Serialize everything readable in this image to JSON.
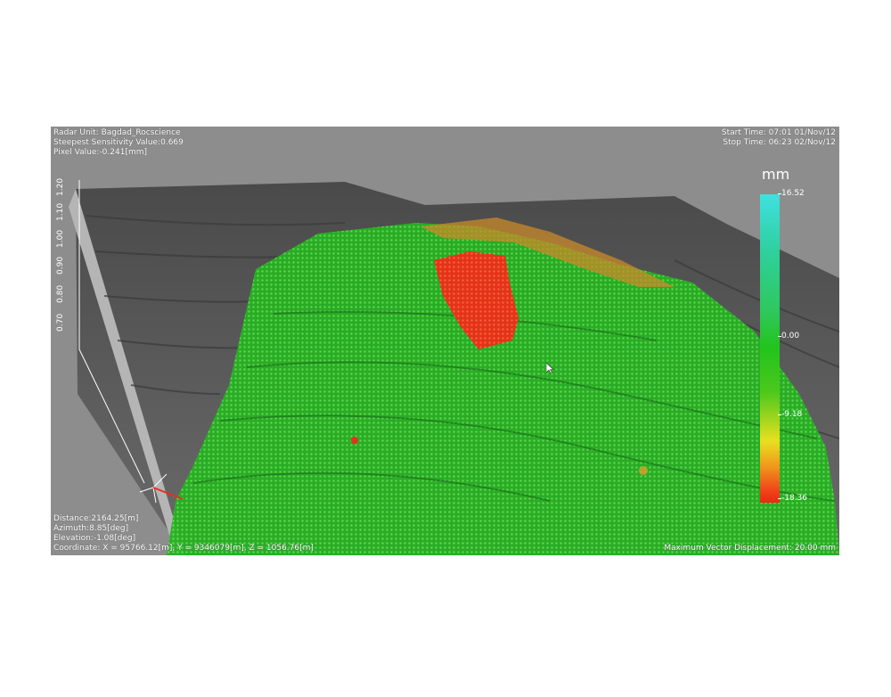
{
  "overlay": {
    "top_left": {
      "radar_unit": "Radar Unit: Bagdad_Rocscience",
      "steepest": "Steepest Sensitivity Value:0.669",
      "pixel_value": "Pixel Value:-0.241[mm]"
    },
    "top_right": {
      "start_time": "Start Time: 07:01 01/Nov/12",
      "stop_time": "Stop Time: 06:23 02/Nov/12"
    },
    "bottom_left": {
      "distance": "Distance:2164.25[m]",
      "azimuth": "Azimuth:8.85[deg]",
      "elevation": "Elevation:-1.08[deg]",
      "coordinate": "Coordinate: X = 95766.12[m], Y = 9346079[m], Z = 1056.76[m]"
    },
    "bottom_right": {
      "max_vector": "Maximum Vector Displacement: 20.00 mm"
    }
  },
  "legend": {
    "unit": "mm",
    "max": "16.52",
    "zero": "0.00",
    "mid_negative": "-9.18",
    "min": "-18.36",
    "colors": {
      "top": "#40e0e0",
      "middle": "#22c41c",
      "yellow": "#e8e020",
      "bottom": "#e82a14"
    }
  },
  "scale_ruler": {
    "labels": [
      "1.20",
      "1.10",
      "1.00",
      "0.90",
      "0.80",
      "0.70"
    ]
  },
  "scene_colors": {
    "terrain": "#5a5a5a",
    "stable": "#2ec42a",
    "moving": "#e8301c"
  }
}
